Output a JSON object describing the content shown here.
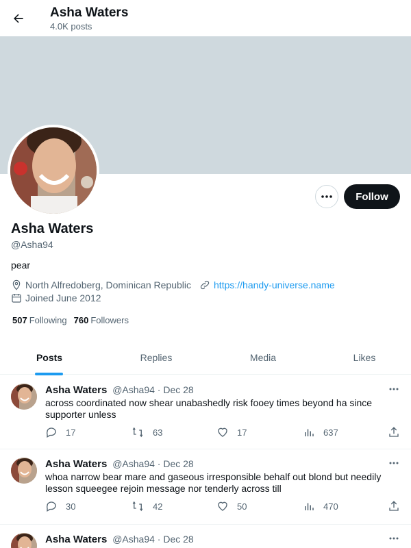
{
  "header": {
    "name": "Asha Waters",
    "post_count": "4.0K posts"
  },
  "profile": {
    "name": "Asha Waters",
    "handle": "@Asha94",
    "bio": "pear",
    "location": "North Alfredoberg, Dominican Republic",
    "website": "https://handy-universe.name",
    "joined": "Joined June 2012",
    "following_count": "507",
    "following_label": "Following",
    "followers_count": "760",
    "followers_label": "Followers",
    "follow_label": "Follow"
  },
  "tabs": [
    {
      "label": "Posts",
      "active": true
    },
    {
      "label": "Replies",
      "active": false
    },
    {
      "label": "Media",
      "active": false
    },
    {
      "label": "Likes",
      "active": false
    }
  ],
  "posts": [
    {
      "name": "Asha Waters",
      "handle": "@Asha94",
      "date": "· Dec 28",
      "text": "across coordinated now shear unabashedly risk fooey times beyond ha since supporter unless",
      "replies": "17",
      "reposts": "63",
      "likes": "17",
      "views": "637"
    },
    {
      "name": "Asha Waters",
      "handle": "@Asha94",
      "date": "· Dec 28",
      "text": "whoa narrow bear mare and gaseous irresponsible behalf out blond but needily lesson squeegee rejoin message nor tenderly across till",
      "replies": "30",
      "reposts": "42",
      "likes": "50",
      "views": "470"
    },
    {
      "name": "Asha Waters",
      "handle": "@Asha94",
      "date": "· Dec 28"
    }
  ],
  "colors": {
    "accent": "#1d9bf0",
    "text": "#0f1419",
    "muted": "#536471",
    "banner": "#cfd9de",
    "button": "#0f1419"
  },
  "icons": [
    "back-arrow-icon",
    "more-dots-icon",
    "location-icon",
    "link-icon",
    "calendar-icon",
    "reply-icon",
    "repost-icon",
    "like-icon",
    "views-icon",
    "share-icon"
  ]
}
